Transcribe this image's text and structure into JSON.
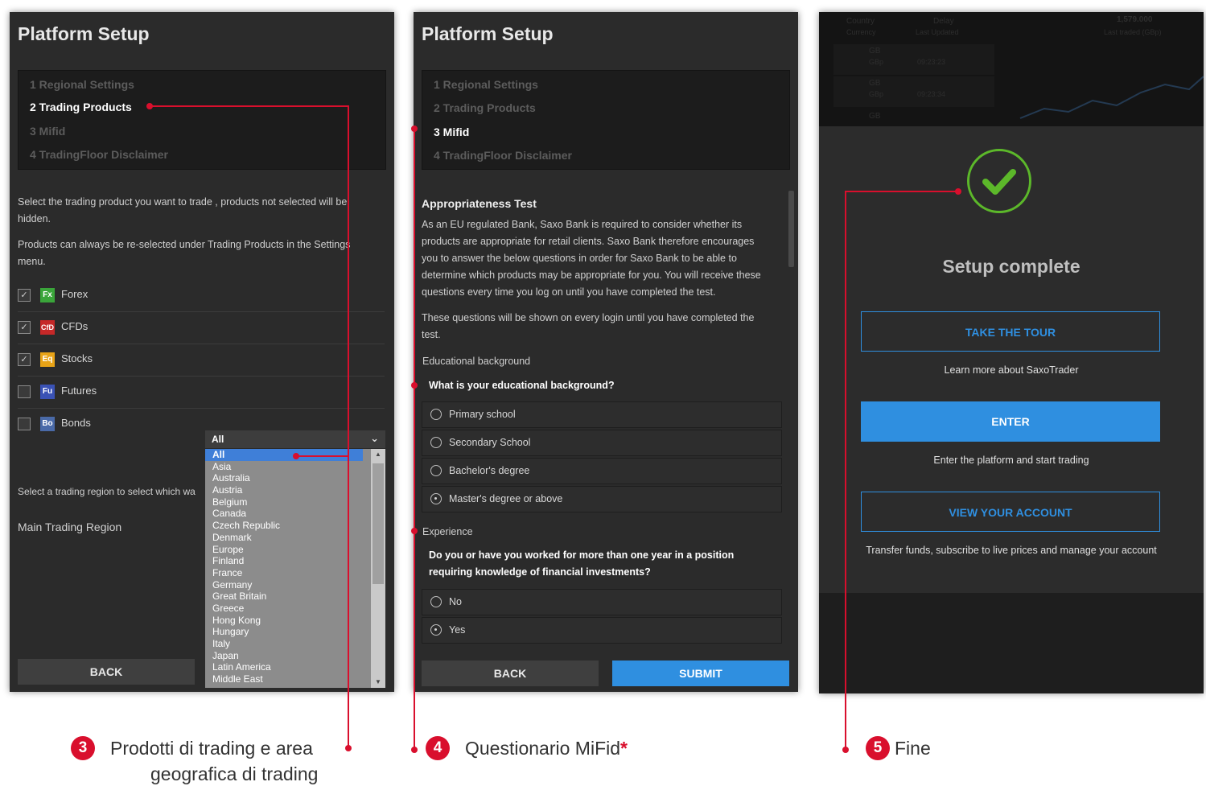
{
  "panel1": {
    "title": "Platform Setup",
    "steps": [
      "1 Regional Settings",
      "2 Trading Products",
      "3 Mifid",
      "4 TradingFloor Disclaimer"
    ],
    "intro_line1": "Select the trading product you want to trade , products not selected will be",
    "intro_line2": "hidden.",
    "intro_line3": "Products can always be re-selected under Trading Products in the Settings",
    "intro_line4": "menu.",
    "products": [
      {
        "badge": "Fx",
        "name": "Forex",
        "checked": true,
        "color": "#3aa53a"
      },
      {
        "badge": "CfD",
        "name": "CFDs",
        "checked": true,
        "color": "#c62828"
      },
      {
        "badge": "Eq",
        "name": "Stocks",
        "checked": true,
        "color": "#e8a317"
      },
      {
        "badge": "Fu",
        "name": "Futures",
        "checked": false,
        "color": "#3a52b5"
      },
      {
        "badge": "Bo",
        "name": "Bonds",
        "checked": false,
        "color": "#4a6aa8"
      }
    ],
    "region_hint": "Select a trading region to select which wa",
    "main_region_label": "Main Trading Region",
    "region_selected": "All",
    "region_options": [
      "All",
      "Asia",
      "Australia",
      "Austria",
      "Belgium",
      "Canada",
      "Czech Republic",
      "Denmark",
      "Europe",
      "Finland",
      "France",
      "Germany",
      "Great Britain",
      "Greece",
      "Hong Kong",
      "Hungary",
      "Italy",
      "Japan",
      "Latin America",
      "Middle East"
    ],
    "back_label": "BACK"
  },
  "panel2": {
    "title": "Platform Setup",
    "steps": [
      "1 Regional Settings",
      "2 Trading Products",
      "3 Mifid",
      "4 TradingFloor Disclaimer"
    ],
    "test_title": "Appropriateness Test",
    "para1": [
      "As an EU regulated Bank, Saxo Bank is required to consider whether its",
      "products are appropriate for retail clients. Saxo Bank therefore encourages",
      "you to answer the below questions in order for Saxo Bank to be able to",
      "determine which products may be appropriate for you. You will receive these",
      "questions every time you log on until you have completed the test."
    ],
    "para2": [
      "These questions will be shown on every login until you have completed the",
      "test."
    ],
    "q1": {
      "header": "Educational background",
      "question": "What is your educational background?",
      "options": [
        "Primary school",
        "Secondary School",
        "Bachelor's degree",
        "Master's degree or above"
      ],
      "selected": 3
    },
    "q2": {
      "header": "Experience",
      "question_line1": "Do you or have you worked for more than one year in a position",
      "question_line2": "requiring knowledge of financial investments?",
      "options": [
        "No",
        "Yes"
      ],
      "selected": 1
    },
    "back_label": "BACK",
    "submit_label": "SUBMIT"
  },
  "panel3": {
    "bg": {
      "col1": "Country",
      "col1b": "Currency",
      "col2": "Delay",
      "col2b": "Last Updated",
      "col3": "1,579.000",
      "col3b": "Last traded  (GBp)",
      "rows": [
        {
          "a": "GB",
          "b": "GBp",
          "t": "09:23:23"
        },
        {
          "a": "GB",
          "b": "GBp",
          "t": "09:23:34"
        },
        {
          "a": "GB",
          "b": "",
          "t": ""
        }
      ]
    },
    "setup_complete": "Setup complete",
    "tour_label": "TAKE THE TOUR",
    "tour_sub": "Learn more about SaxoTrader",
    "enter_label": "ENTER",
    "enter_sub": "Enter the platform and start trading",
    "account_label": "VIEW YOUR ACCOUNT",
    "account_sub": "Transfer funds, subscribe to live prices and manage your account",
    "accent": "#2f8fe0",
    "success_color": "#5cb82a"
  },
  "captions": {
    "c3": {
      "num": "3",
      "line1": "Prodotti di trading e area",
      "line2": "geografica di trading"
    },
    "c4": {
      "num": "4",
      "text": "Questionario MiFid",
      "star": "*"
    },
    "c5": {
      "num": "5",
      "text": "Fine"
    }
  },
  "callout_color": "#d90f2d"
}
